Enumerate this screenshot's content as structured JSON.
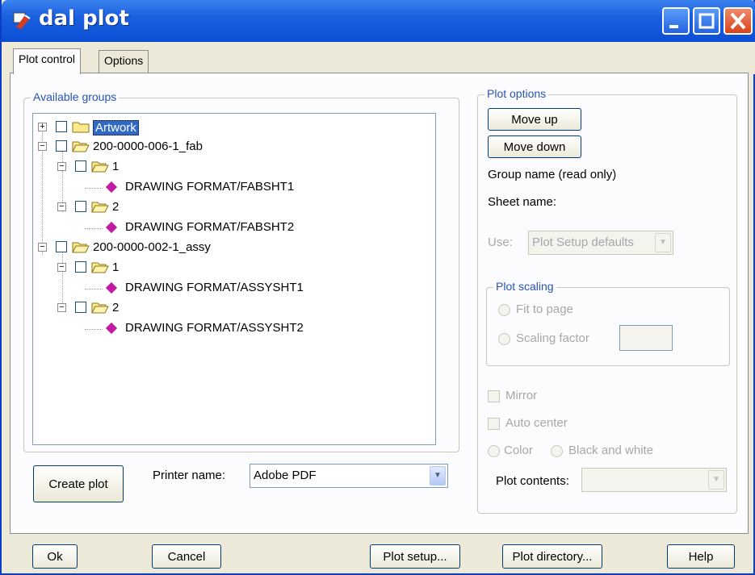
{
  "window": {
    "title": "dal plot",
    "tabs": [
      "Plot control",
      "Options"
    ]
  },
  "available_groups": {
    "legend": "Available groups",
    "tree": [
      {
        "label": "Artwork",
        "selected": true
      },
      {
        "label": "200-0000-006-1_fab"
      },
      {
        "label": "1"
      },
      {
        "label": "DRAWING FORMAT/FABSHT1"
      },
      {
        "label": "2"
      },
      {
        "label": "DRAWING FORMAT/FABSHT2"
      },
      {
        "label": "200-0000-002-1_assy"
      },
      {
        "label": "1"
      },
      {
        "label": "DRAWING FORMAT/ASSYSHT1"
      },
      {
        "label": "2"
      },
      {
        "label": "DRAWING FORMAT/ASSYSHT2"
      }
    ]
  },
  "bottom_left": {
    "create_plot": "Create plot",
    "printer_label": "Printer name:",
    "printer_value": "Adobe PDF"
  },
  "plot_options": {
    "legend": "Plot options",
    "move_up": "Move up",
    "move_down": "Move down",
    "group_name": "Group name (read only)",
    "sheet_name": "Sheet name:",
    "use_label": "Use:",
    "use_value": "Plot Setup defaults",
    "scaling_legend": "Plot scaling",
    "fit_to_page": "Fit to page",
    "scaling_factor": "Scaling factor",
    "mirror": "Mirror",
    "auto_center": "Auto center",
    "color": "Color",
    "black_white": "Black and white",
    "plot_contents": "Plot contents:"
  },
  "footer": {
    "ok": "Ok",
    "cancel": "Cancel",
    "plot_setup": "Plot setup...",
    "plot_directory": "Plot directory...",
    "help": "Help"
  }
}
